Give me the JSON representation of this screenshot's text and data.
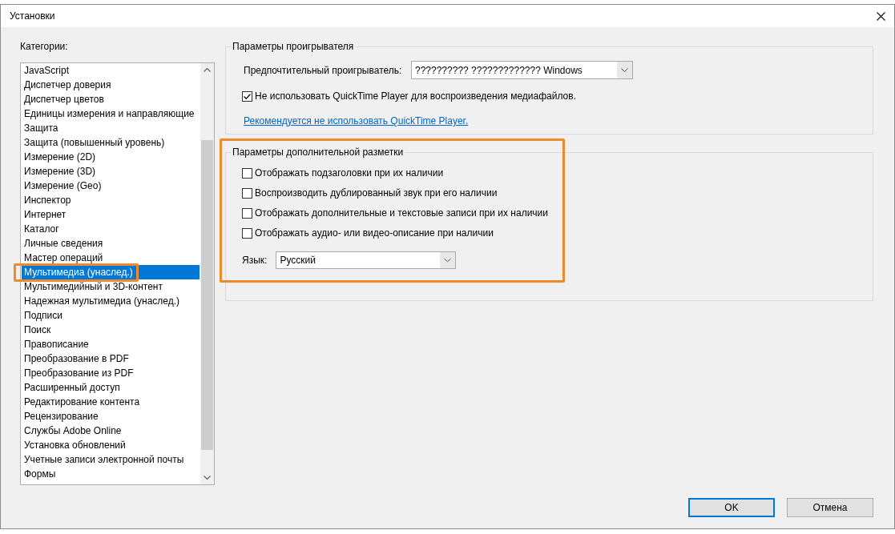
{
  "window": {
    "title": "Установки"
  },
  "categories": {
    "label": "Категории:",
    "items": [
      {
        "label": "JavaScript",
        "selected": false,
        "highlighted": false
      },
      {
        "label": "Диспетчер доверия",
        "selected": false,
        "highlighted": false
      },
      {
        "label": "Диспетчер цветов",
        "selected": false,
        "highlighted": false
      },
      {
        "label": "Единицы измерения и направляющие",
        "selected": false,
        "highlighted": false
      },
      {
        "label": "Защита",
        "selected": false,
        "highlighted": false
      },
      {
        "label": "Защита (повышенный уровень)",
        "selected": false,
        "highlighted": false
      },
      {
        "label": "Измерение (2D)",
        "selected": false,
        "highlighted": false
      },
      {
        "label": "Измерение (3D)",
        "selected": false,
        "highlighted": false
      },
      {
        "label": "Измерение (Geo)",
        "selected": false,
        "highlighted": false
      },
      {
        "label": "Инспектор",
        "selected": false,
        "highlighted": false
      },
      {
        "label": "Интернет",
        "selected": false,
        "highlighted": false
      },
      {
        "label": "Каталог",
        "selected": false,
        "highlighted": false
      },
      {
        "label": "Личные сведения",
        "selected": false,
        "highlighted": false
      },
      {
        "label": "Мастер операций",
        "selected": false,
        "highlighted": false
      },
      {
        "label": "Мультимедиа (унаслед.)",
        "selected": true,
        "highlighted": true
      },
      {
        "label": "Мультимедийный и 3D-контент",
        "selected": false,
        "highlighted": false
      },
      {
        "label": "Надежная мультимедиа (унаслед.)",
        "selected": false,
        "highlighted": false
      },
      {
        "label": "Подписи",
        "selected": false,
        "highlighted": false
      },
      {
        "label": "Поиск",
        "selected": false,
        "highlighted": false
      },
      {
        "label": "Правописание",
        "selected": false,
        "highlighted": false
      },
      {
        "label": "Преобразование в PDF",
        "selected": false,
        "highlighted": false
      },
      {
        "label": "Преобразование из PDF",
        "selected": false,
        "highlighted": false
      },
      {
        "label": "Расширенный доступ",
        "selected": false,
        "highlighted": false
      },
      {
        "label": "Редактирование контента",
        "selected": false,
        "highlighted": false
      },
      {
        "label": "Рецензирование",
        "selected": false,
        "highlighted": false
      },
      {
        "label": "Службы Adobe Online",
        "selected": false,
        "highlighted": false
      },
      {
        "label": "Установка обновлений",
        "selected": false,
        "highlighted": false
      },
      {
        "label": "Учетные записи электронной почты",
        "selected": false,
        "highlighted": false
      },
      {
        "label": "Формы",
        "selected": false,
        "highlighted": false
      }
    ]
  },
  "player_settings": {
    "title": "Параметры проигрывателя",
    "player": {
      "label": "Предпочтительный проигрыватель:",
      "value": "?????????? ????????????? Windows"
    },
    "options": [
      {
        "label": "Не использовать QuickTime Player для воспроизведения медиафайлов.",
        "checked": true
      }
    ],
    "link": "Рекомендуется не использовать QuickTime Player."
  },
  "markup_settings": {
    "title": "Параметры дополнительной разметки",
    "highlighted": true,
    "options": [
      {
        "label": "Отображать подзаголовки при их наличии",
        "checked": false
      },
      {
        "label": "Воспроизводить дублированный звук при его наличии",
        "checked": false
      },
      {
        "label": "Отображать дополнительные и текстовые записи при их наличии",
        "checked": false
      },
      {
        "label": "Отображать аудио- или видео-описание при наличии",
        "checked": false
      }
    ],
    "language": {
      "label": "Язык:",
      "value": "Русский"
    }
  },
  "buttons": [
    {
      "label": "OK",
      "default": true
    },
    {
      "label": "Отмена",
      "default": false
    }
  ]
}
